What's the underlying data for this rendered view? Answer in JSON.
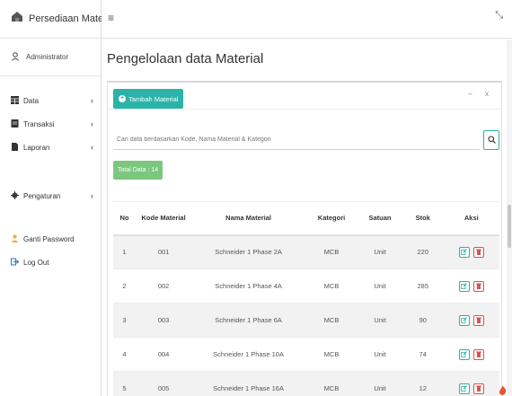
{
  "app": {
    "brand": "Persediaan Material"
  },
  "user": {
    "name": "Administrator"
  },
  "sidebar": {
    "items": [
      {
        "label": "Data",
        "icon": "grid-icon",
        "chevron": "‹"
      },
      {
        "label": "Transaksi",
        "icon": "file-icon",
        "chevron": "‹"
      },
      {
        "label": "Laporan",
        "icon": "document-icon",
        "chevron": "‹"
      },
      {
        "label": "Pengaturan",
        "icon": "gear-icon",
        "chevron": "‹"
      },
      {
        "label": "Ganti Password",
        "icon": "user-icon"
      },
      {
        "label": "Log Out",
        "icon": "logout-icon"
      }
    ]
  },
  "topbar": {
    "menu_icon": "≡",
    "expand_icon": "⤡"
  },
  "page": {
    "title": "Pengelolaan data Material"
  },
  "box": {
    "add_label": "Tambah Material",
    "tools": "– x"
  },
  "search": {
    "placeholder": "Cari data berdasarkan Kode, Nama Material & Kategori"
  },
  "total": {
    "label": "Total Data : 14"
  },
  "table": {
    "headers": [
      "No",
      "Kode Material",
      "Nama Material",
      "Kategori",
      "Satuan",
      "Stok",
      "Aksi"
    ],
    "rows": [
      [
        "1",
        "001",
        "Schneider 1 Phase 2A",
        "MCB",
        "Unit",
        "220"
      ],
      [
        "2",
        "002",
        "Schneider 1 Phase 4A",
        "MCB",
        "Unit",
        "285"
      ],
      [
        "3",
        "003",
        "Schneider 1 Phase 6A",
        "MCB",
        "Unit",
        "90"
      ],
      [
        "4",
        "004",
        "Schneider 1 Phase 10A",
        "MCB",
        "Unit",
        "74"
      ],
      [
        "5",
        "005",
        "Schneider 1 Phase 16A",
        "MCB",
        "Unit",
        "12"
      ]
    ]
  },
  "colors": {
    "accent": "#2ab3a8",
    "success": "#7bc77e",
    "danger": "#d9534f",
    "warning": "#f0ad4e"
  }
}
